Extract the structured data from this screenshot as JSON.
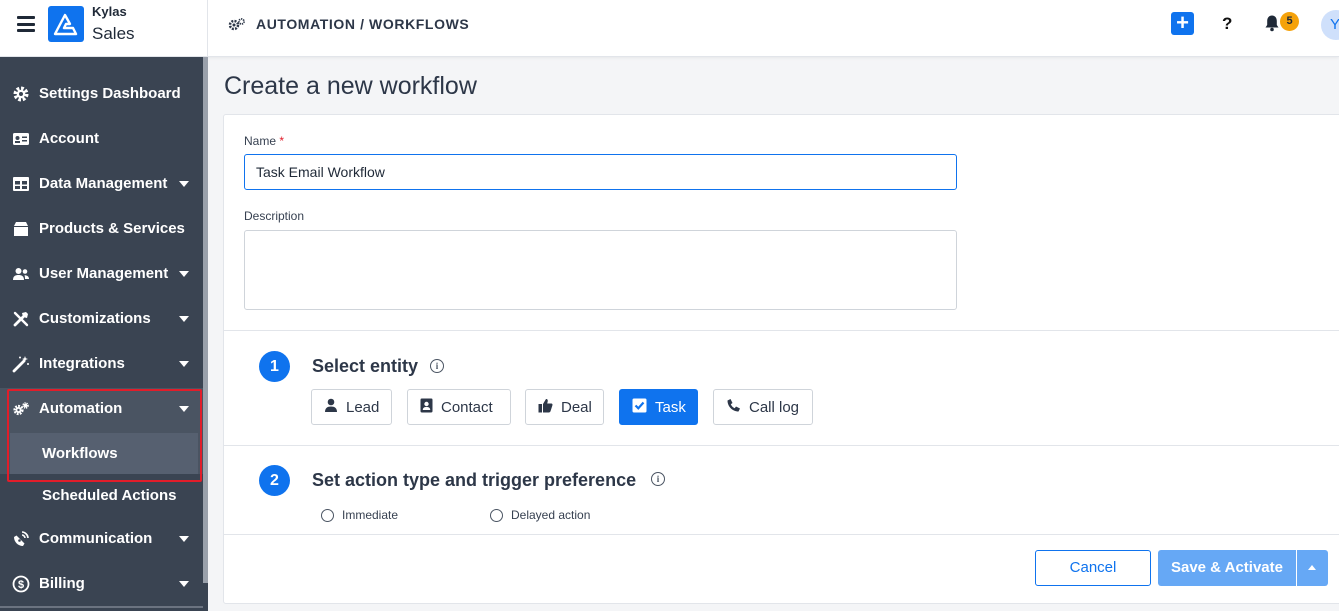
{
  "app": {
    "brand_top": "Kylas",
    "brand_bottom": "Sales"
  },
  "header": {
    "breadcrumb": "AUTOMATION / WORKFLOWS",
    "plus_label": "+",
    "help_label": "?",
    "notification_count": "5",
    "avatar_initial": "Y"
  },
  "sidebar": {
    "items": [
      {
        "label": "Settings Dashboard",
        "icon": "gear-icon"
      },
      {
        "label": "Account",
        "icon": "id-card-icon"
      },
      {
        "label": "Data Management",
        "icon": "table-icon"
      },
      {
        "label": "Products & Services",
        "icon": "box-icon"
      },
      {
        "label": "User Management",
        "icon": "users-icon"
      },
      {
        "label": "Customizations",
        "icon": "tools-icon"
      },
      {
        "label": "Integrations",
        "icon": "magic-wand-icon"
      },
      {
        "label": "Automation",
        "icon": "cogs-icon"
      },
      {
        "label": "Communication",
        "icon": "satellite-dish-icon"
      },
      {
        "label": "Billing",
        "icon": "dollar-circle-icon"
      }
    ],
    "sub_items": [
      {
        "label": "Workflows"
      },
      {
        "label": "Scheduled Actions"
      }
    ]
  },
  "main": {
    "title": "Create a new workflow",
    "name_label": "Name",
    "required_mark": "*",
    "name_value": "Task Email Workflow",
    "description_label": "Description",
    "description_value": "",
    "step1": {
      "number": "1",
      "title": "Select entity",
      "info": "i"
    },
    "entities": [
      {
        "label": "Lead",
        "icon": "user-icon",
        "selected": false
      },
      {
        "label": "Contact",
        "icon": "contact-card-icon",
        "selected": false
      },
      {
        "label": "Deal",
        "icon": "thumbs-up-icon",
        "selected": false
      },
      {
        "label": "Task",
        "icon": "check-square-icon",
        "selected": true
      },
      {
        "label": "Call log",
        "icon": "phone-icon",
        "selected": false
      }
    ],
    "step2": {
      "number": "2",
      "title": "Set action type and trigger preference",
      "info": "i"
    },
    "trigger_options": [
      {
        "label": "Immediate"
      },
      {
        "label": "Delayed action"
      }
    ],
    "cancel_label": "Cancel",
    "save_label": "Save & Activate"
  },
  "colors": {
    "primary": "#0f73ee",
    "sidebar": "#3a4452",
    "badge": "#f5a20a",
    "highlight": "#e11d2a"
  }
}
